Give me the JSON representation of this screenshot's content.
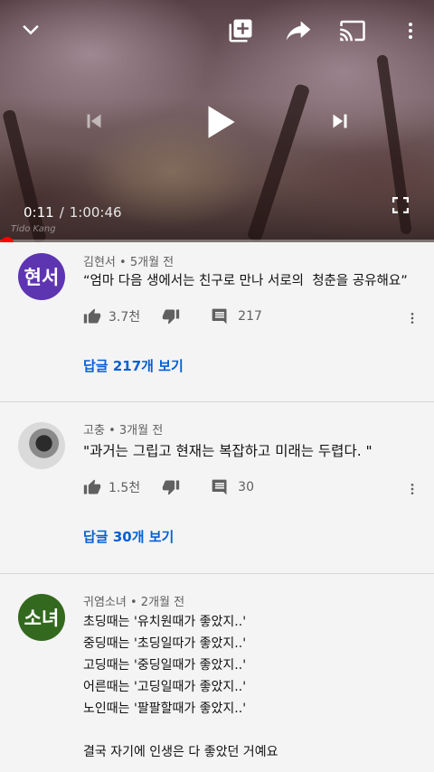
{
  "player": {
    "current_time": "0:11",
    "separator": "/",
    "duration": "1:00:46",
    "watermark": "Tido Kang",
    "progress_fraction": 0.003
  },
  "comments": [
    {
      "avatar_text": "현서",
      "avatar_color": "#5e35b1",
      "author": "김현서",
      "age": "5개월 전",
      "text": "“엄마 다음 생에서는 친구로 만나 서로의  청춘을 공유해요”",
      "likes": "3.7천",
      "reply_count": "217",
      "replies_label": "답글 217개 보기"
    },
    {
      "avatar_text": "",
      "author": "고충",
      "age": "3개월 전",
      "text": "\"과거는 그립고 현재는 복잡하고 미래는 두렵다. \"",
      "likes": "1.5천",
      "reply_count": "30",
      "replies_label": "답글 30개 보기"
    },
    {
      "avatar_text": "소녀",
      "avatar_color": "#33691e",
      "author": "귀염소녀",
      "age": "2개월 전",
      "text": "초딩때는 '유치원때가 좋았지..'\n중딩때는 '초딩일따가 좋았지..'\n고딩때는 '중딩일때가 좋았지..'\n어른때는 '고딩일때가 좋았지..'\n노인때는 '팔팔할때가 좋았지..'\n\n결국 자기에 인생은 다 좋았던 거예요"
    }
  ],
  "dot_separator": "•",
  "icons": {
    "collapse": "chevron-down-icon",
    "add_to_playlist": "playlist-add-icon",
    "share": "share-icon",
    "cast": "cast-icon",
    "menu": "more-vert-icon",
    "previous": "skip-previous-icon",
    "play": "play-icon",
    "next": "skip-next-icon",
    "fullscreen": "fullscreen-icon",
    "like": "thumb-up-icon",
    "dislike": "thumb-down-icon",
    "reply": "comment-icon"
  }
}
